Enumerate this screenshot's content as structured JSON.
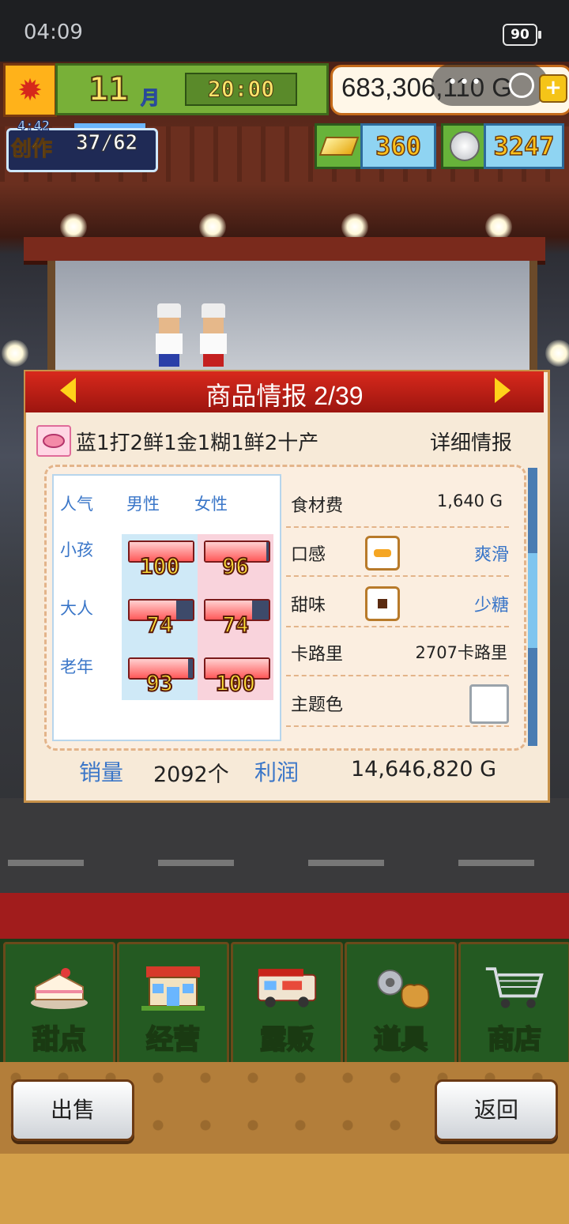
{
  "status_bar": {
    "time": "04:09",
    "battery": "90"
  },
  "hud": {
    "month": "11",
    "month_unit": "月",
    "game_time": "20:00",
    "money": "683,306,110 G",
    "create_timer": "4:42",
    "create_label": "创作",
    "create_count": "37/62",
    "gold": "360",
    "silver": "3247"
  },
  "dialog": {
    "title": "商品情报 2/39",
    "product_name": "蓝1打2鲜1金1糊1鲜2十产",
    "detail_link": "详细情报",
    "popularity": {
      "header": "人气",
      "male": "男性",
      "female": "女性",
      "rows": [
        {
          "label": "小孩",
          "male": "100",
          "female": "96"
        },
        {
          "label": "大人",
          "male": "74",
          "female": "74"
        },
        {
          "label": "老年",
          "male": "93",
          "female": "100"
        }
      ]
    },
    "attributes": {
      "ingredient_cost_label": "食材费",
      "ingredient_cost": "1,640 G",
      "texture_label": "口感",
      "texture": "爽滑",
      "sweetness_label": "甜味",
      "sweetness": "少糖",
      "calorie_label": "卡路里",
      "calorie": "2707卡路里",
      "theme_color_label": "主题色",
      "theme_color": "#ffffff"
    },
    "sales_label": "销量",
    "sales": "2092个",
    "profit_label": "利润",
    "profit": "14,646,820 G"
  },
  "menu": {
    "items": [
      {
        "label": "甜点",
        "icon": "cake-icon"
      },
      {
        "label": "经营",
        "icon": "shop-building-icon"
      },
      {
        "label": "露贩",
        "icon": "food-truck-icon"
      },
      {
        "label": "道具",
        "icon": "gear-bag-icon"
      },
      {
        "label": "商店",
        "icon": "shopping-cart-icon"
      }
    ]
  },
  "buttons": {
    "sell": "出售",
    "back": "返回"
  },
  "colors": {
    "accent_red": "#c8241a",
    "popularity_blue": "#3a76c8",
    "menu_green": "#245a22"
  }
}
